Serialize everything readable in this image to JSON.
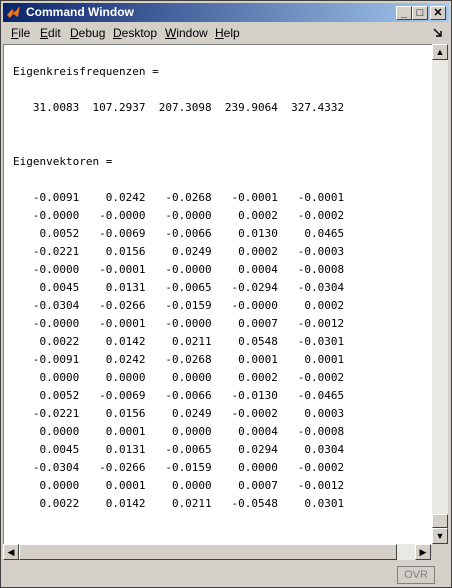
{
  "window": {
    "title": "Command Window",
    "controls": {
      "minimize": "_",
      "maximize": "□",
      "close": "✕"
    }
  },
  "menu": {
    "items": [
      {
        "label": "File",
        "mnemonic": "F",
        "rest": "ile"
      },
      {
        "label": "Edit",
        "mnemonic": "E",
        "rest": "dit"
      },
      {
        "label": "Debug",
        "mnemonic": "D",
        "rest": "ebug"
      },
      {
        "label": "Desktop",
        "mnemonic": "D",
        "rest": "esktop"
      },
      {
        "label": "Window",
        "mnemonic": "W",
        "rest": "indow"
      },
      {
        "label": "Help",
        "mnemonic": "H",
        "rest": "elp"
      }
    ],
    "undock_icon": "undock-arrow-icon"
  },
  "console": {
    "lines": [
      "",
      "Eigenkreisfrequenzen =",
      "",
      "   31.0083  107.2937  207.3098  239.9064  327.4332",
      "",
      "",
      "Eigenvektoren =",
      "",
      "   -0.0091    0.0242   -0.0268   -0.0001   -0.0001",
      "   -0.0000   -0.0000   -0.0000    0.0002   -0.0002",
      "    0.0052   -0.0069   -0.0066    0.0130    0.0465",
      "   -0.0221    0.0156    0.0249    0.0002   -0.0003",
      "   -0.0000   -0.0001   -0.0000    0.0004   -0.0008",
      "    0.0045    0.0131   -0.0065   -0.0294   -0.0304",
      "   -0.0304   -0.0266   -0.0159   -0.0000    0.0002",
      "   -0.0000   -0.0001   -0.0000    0.0007   -0.0012",
      "    0.0022    0.0142    0.0211    0.0548   -0.0301",
      "   -0.0091    0.0242   -0.0268    0.0001    0.0001",
      "    0.0000    0.0000    0.0000    0.0002   -0.0002",
      "    0.0052   -0.0069   -0.0066   -0.0130   -0.0465",
      "   -0.0221    0.0156    0.0249   -0.0002    0.0003",
      "    0.0000    0.0001    0.0000    0.0004   -0.0008",
      "    0.0045    0.0131   -0.0065    0.0294    0.0304",
      "   -0.0304   -0.0266   -0.0159    0.0000   -0.0002",
      "    0.0000    0.0001    0.0000    0.0007   -0.0012",
      "    0.0022    0.0142    0.0211   -0.0548    0.0301",
      "",
      "",
      ">>"
    ]
  },
  "status": {
    "ovr": "OVR"
  }
}
